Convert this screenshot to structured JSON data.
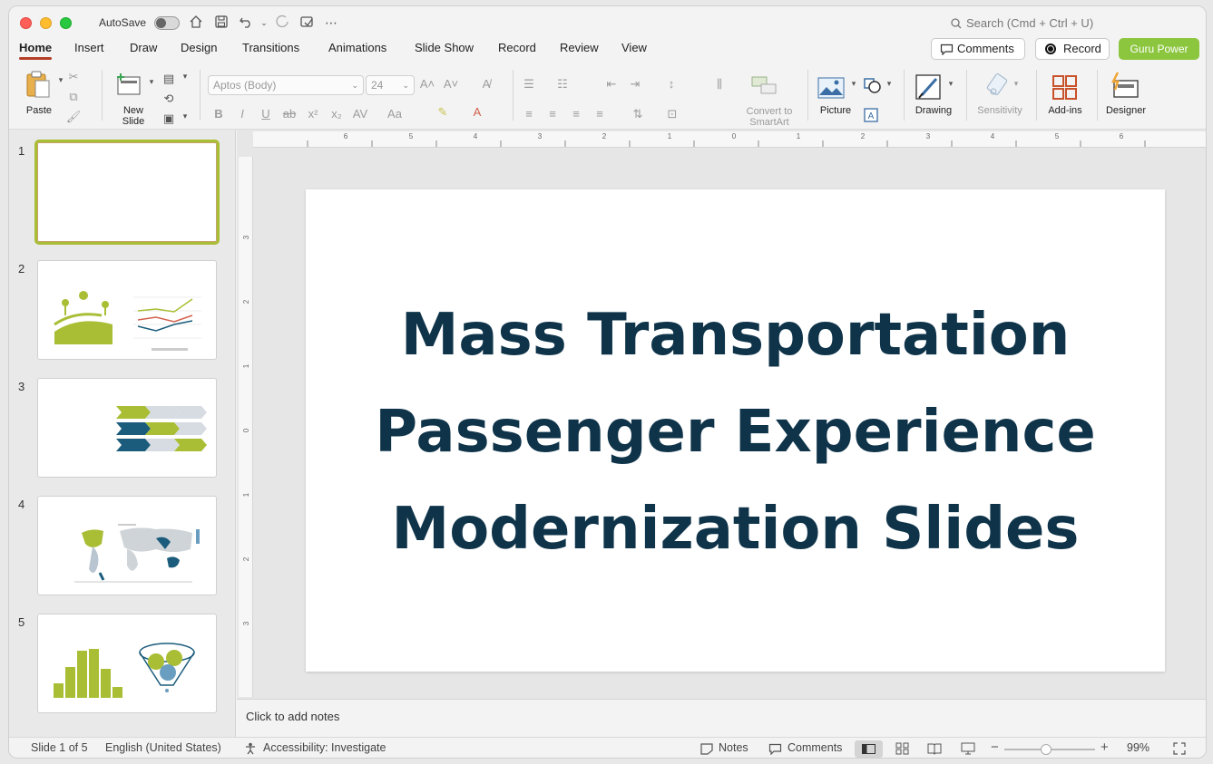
{
  "titlebar": {
    "autosave_label": "AutoSave",
    "search_placeholder": "Search (Cmd + Ctrl + U)"
  },
  "tabs": [
    "Home",
    "Insert",
    "Draw",
    "Design",
    "Transitions",
    "Animations",
    "Slide Show",
    "Record",
    "Review",
    "View"
  ],
  "actions": {
    "comments": "Comments",
    "record": "Record",
    "guru": "Guru Power"
  },
  "ribbon": {
    "paste": "Paste",
    "new_slide_1": "New",
    "new_slide_2": "Slide",
    "font_name": "Aptos (Body)",
    "font_size": "24",
    "convert_1": "Convert to",
    "convert_2": "SmartArt",
    "picture": "Picture",
    "drawing": "Drawing",
    "sensitivity": "Sensitivity",
    "addins": "Add-ins",
    "designer": "Designer"
  },
  "thumbnails": [
    "1",
    "2",
    "3",
    "4",
    "5"
  ],
  "slide": {
    "title_line1": "Mass Transportation",
    "title_line2": "Passenger Experience",
    "title_line3": "Modernization Slides",
    "title_color": "#0f344a"
  },
  "notes_placeholder": "Click to add notes",
  "status": {
    "slide_count": "Slide 1 of 5",
    "language": "English (United States)",
    "accessibility": "Accessibility: Investigate",
    "notes": "Notes",
    "comments": "Comments",
    "zoom": "99%"
  },
  "accent_colors": {
    "tab_underline": "#b33d26",
    "guru_button": "#8cc63f",
    "thumb_border": "#a9be34"
  }
}
